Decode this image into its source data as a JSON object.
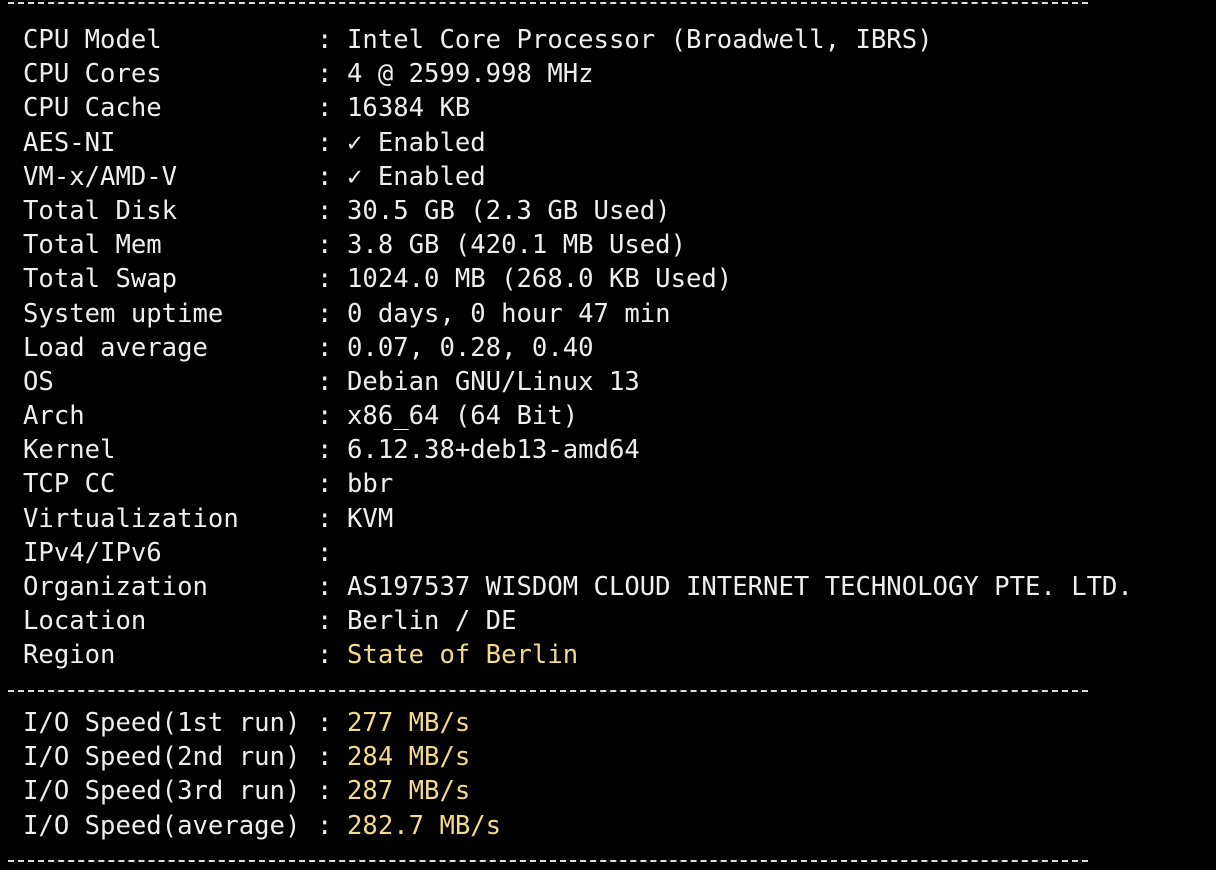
{
  "separator": "-------------------------------------------------------------------",
  "accent_color": "#f3d98a",
  "system_info": [
    {
      "label": "CPU Model",
      "value": "Intel Core Processor (Broadwell, IBRS)",
      "highlight": false
    },
    {
      "label": "CPU Cores",
      "value": "4 @ 2599.998 MHz",
      "highlight": false
    },
    {
      "label": "CPU Cache",
      "value": "16384 KB",
      "highlight": false
    },
    {
      "label": "AES-NI",
      "value": "✓ Enabled",
      "highlight": false
    },
    {
      "label": "VM-x/AMD-V",
      "value": "✓ Enabled",
      "highlight": false
    },
    {
      "label": "Total Disk",
      "value": "30.5 GB (2.3 GB Used)",
      "highlight": false
    },
    {
      "label": "Total Mem",
      "value": "3.8 GB (420.1 MB Used)",
      "highlight": false
    },
    {
      "label": "Total Swap",
      "value": "1024.0 MB (268.0 KB Used)",
      "highlight": false
    },
    {
      "label": "System uptime",
      "value": "0 days, 0 hour 47 min",
      "highlight": false
    },
    {
      "label": "Load average",
      "value": "0.07, 0.28, 0.40",
      "highlight": false
    },
    {
      "label": "OS",
      "value": "Debian GNU/Linux 13",
      "highlight": false
    },
    {
      "label": "Arch",
      "value": "x86_64 (64 Bit)",
      "highlight": false
    },
    {
      "label": "Kernel",
      "value": "6.12.38+deb13-amd64",
      "highlight": false
    },
    {
      "label": "TCP CC",
      "value": "bbr",
      "highlight": false
    },
    {
      "label": "Virtualization",
      "value": "KVM",
      "highlight": false
    },
    {
      "label": "IPv4/IPv6",
      "value": "",
      "highlight": false
    },
    {
      "label": "Organization",
      "value": "AS197537 WISDOM CLOUD INTERNET TECHNOLOGY PTE. LTD.",
      "highlight": false
    },
    {
      "label": "Location",
      "value": "Berlin / DE",
      "highlight": false
    },
    {
      "label": "Region",
      "value": "State of Berlin",
      "highlight": true
    }
  ],
  "io_speed": [
    {
      "label": "I/O Speed(1st run)",
      "value": "277 MB/s"
    },
    {
      "label": "I/O Speed(2nd run)",
      "value": "284 MB/s"
    },
    {
      "label": "I/O Speed(3rd run)",
      "value": "287 MB/s"
    },
    {
      "label": "I/O Speed(average)",
      "value": "282.7 MB/s"
    }
  ],
  "colon": ":"
}
